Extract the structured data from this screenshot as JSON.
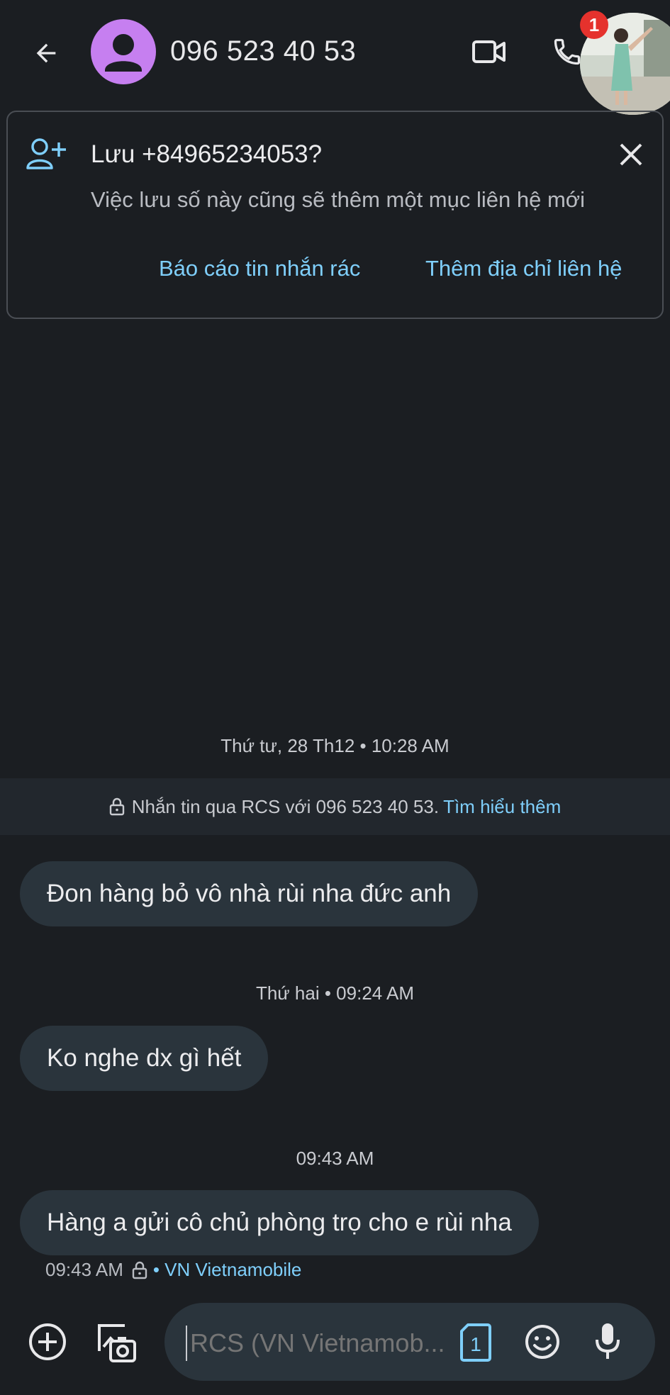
{
  "header": {
    "contact_name": "096 523 40 53",
    "badge_count": "1"
  },
  "save_card": {
    "title": "Lưu +84965234053?",
    "subtitle": "Việc lưu số này cũng sẽ thêm một mục liên hệ mới",
    "report_label": "Báo cáo tin nhắn rác",
    "add_contact_label": "Thêm địa chỉ liên hệ"
  },
  "conversation": {
    "timestamp_1": "Thứ tư, 28 Th12 • 10:28 AM",
    "rcs_notice": "Nhắn tin qua RCS với 096 523 40 53.",
    "rcs_link": "Tìm hiểu thêm",
    "messages": [
      {
        "text": "Đon hàng bỏ vô nhà rùi nha đức anh"
      },
      {
        "text": "Ko nghe dx gì hết"
      },
      {
        "text": "Hàng a gửi cô chủ phòng trọ cho e rùi nha"
      }
    ],
    "timestamp_2": "Thứ hai • 09:24 AM",
    "timestamp_3": "09:43 AM",
    "last_meta_time": "09:43 AM",
    "last_meta_carrier": "• VN Vietnamobile"
  },
  "composer": {
    "placeholder": "RCS (VN Vietnamob...",
    "sim_number": "1"
  },
  "colors": {
    "background": "#1b1e22",
    "bubble": "#2a343c",
    "accent_link": "#7fcffb",
    "avatar": "#c67ff0",
    "badge": "#e5322d"
  }
}
